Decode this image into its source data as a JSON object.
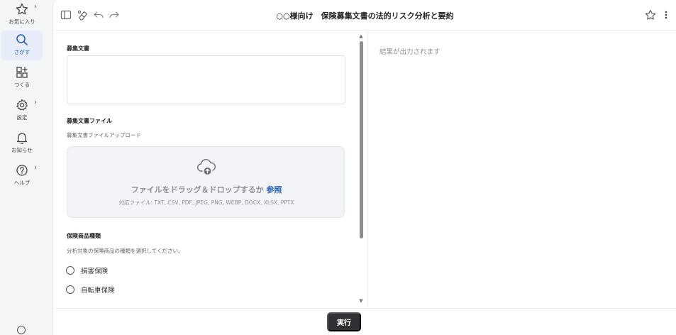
{
  "sidebar": {
    "items": [
      {
        "label": "お気に入り",
        "icon": "star-icon",
        "chevron": "›"
      },
      {
        "label": "さがす",
        "icon": "search-icon",
        "active": true
      },
      {
        "label": "つくる",
        "icon": "grid-plus-icon"
      },
      {
        "label": "設定",
        "icon": "gear-icon",
        "chevron": "›"
      },
      {
        "label": "お知らせ",
        "icon": "bell-icon"
      },
      {
        "label": "ヘルプ",
        "icon": "help-icon",
        "chevron": "›"
      }
    ]
  },
  "header": {
    "title": "○○様向け　保険募集文書の法的リスク分析と要約"
  },
  "form": {
    "document_label": "募集文書",
    "file_label": "募集文書ファイル",
    "file_help": "募集文書ファイルアップロード",
    "dropzone": {
      "main_text": "ファイルをドラッグ＆ドロップするか",
      "link_text": "参照",
      "supported": "対応ファイル: TXT, CSV, PDF, JPEG, PNG, WEBP, DOCX, XLSX, PPTX"
    },
    "product_type_label": "保険商品種類",
    "product_type_help": "分析対象の保険商品の種類を選択してください。",
    "options": [
      "損害保険",
      "自転車保険"
    ]
  },
  "result": {
    "placeholder": "結果が出力されます"
  },
  "actions": {
    "run_label": "実行"
  },
  "colors": {
    "accent": "#2a63b8",
    "active_bg": "#e6edf8",
    "button_bg": "#2f3135"
  }
}
